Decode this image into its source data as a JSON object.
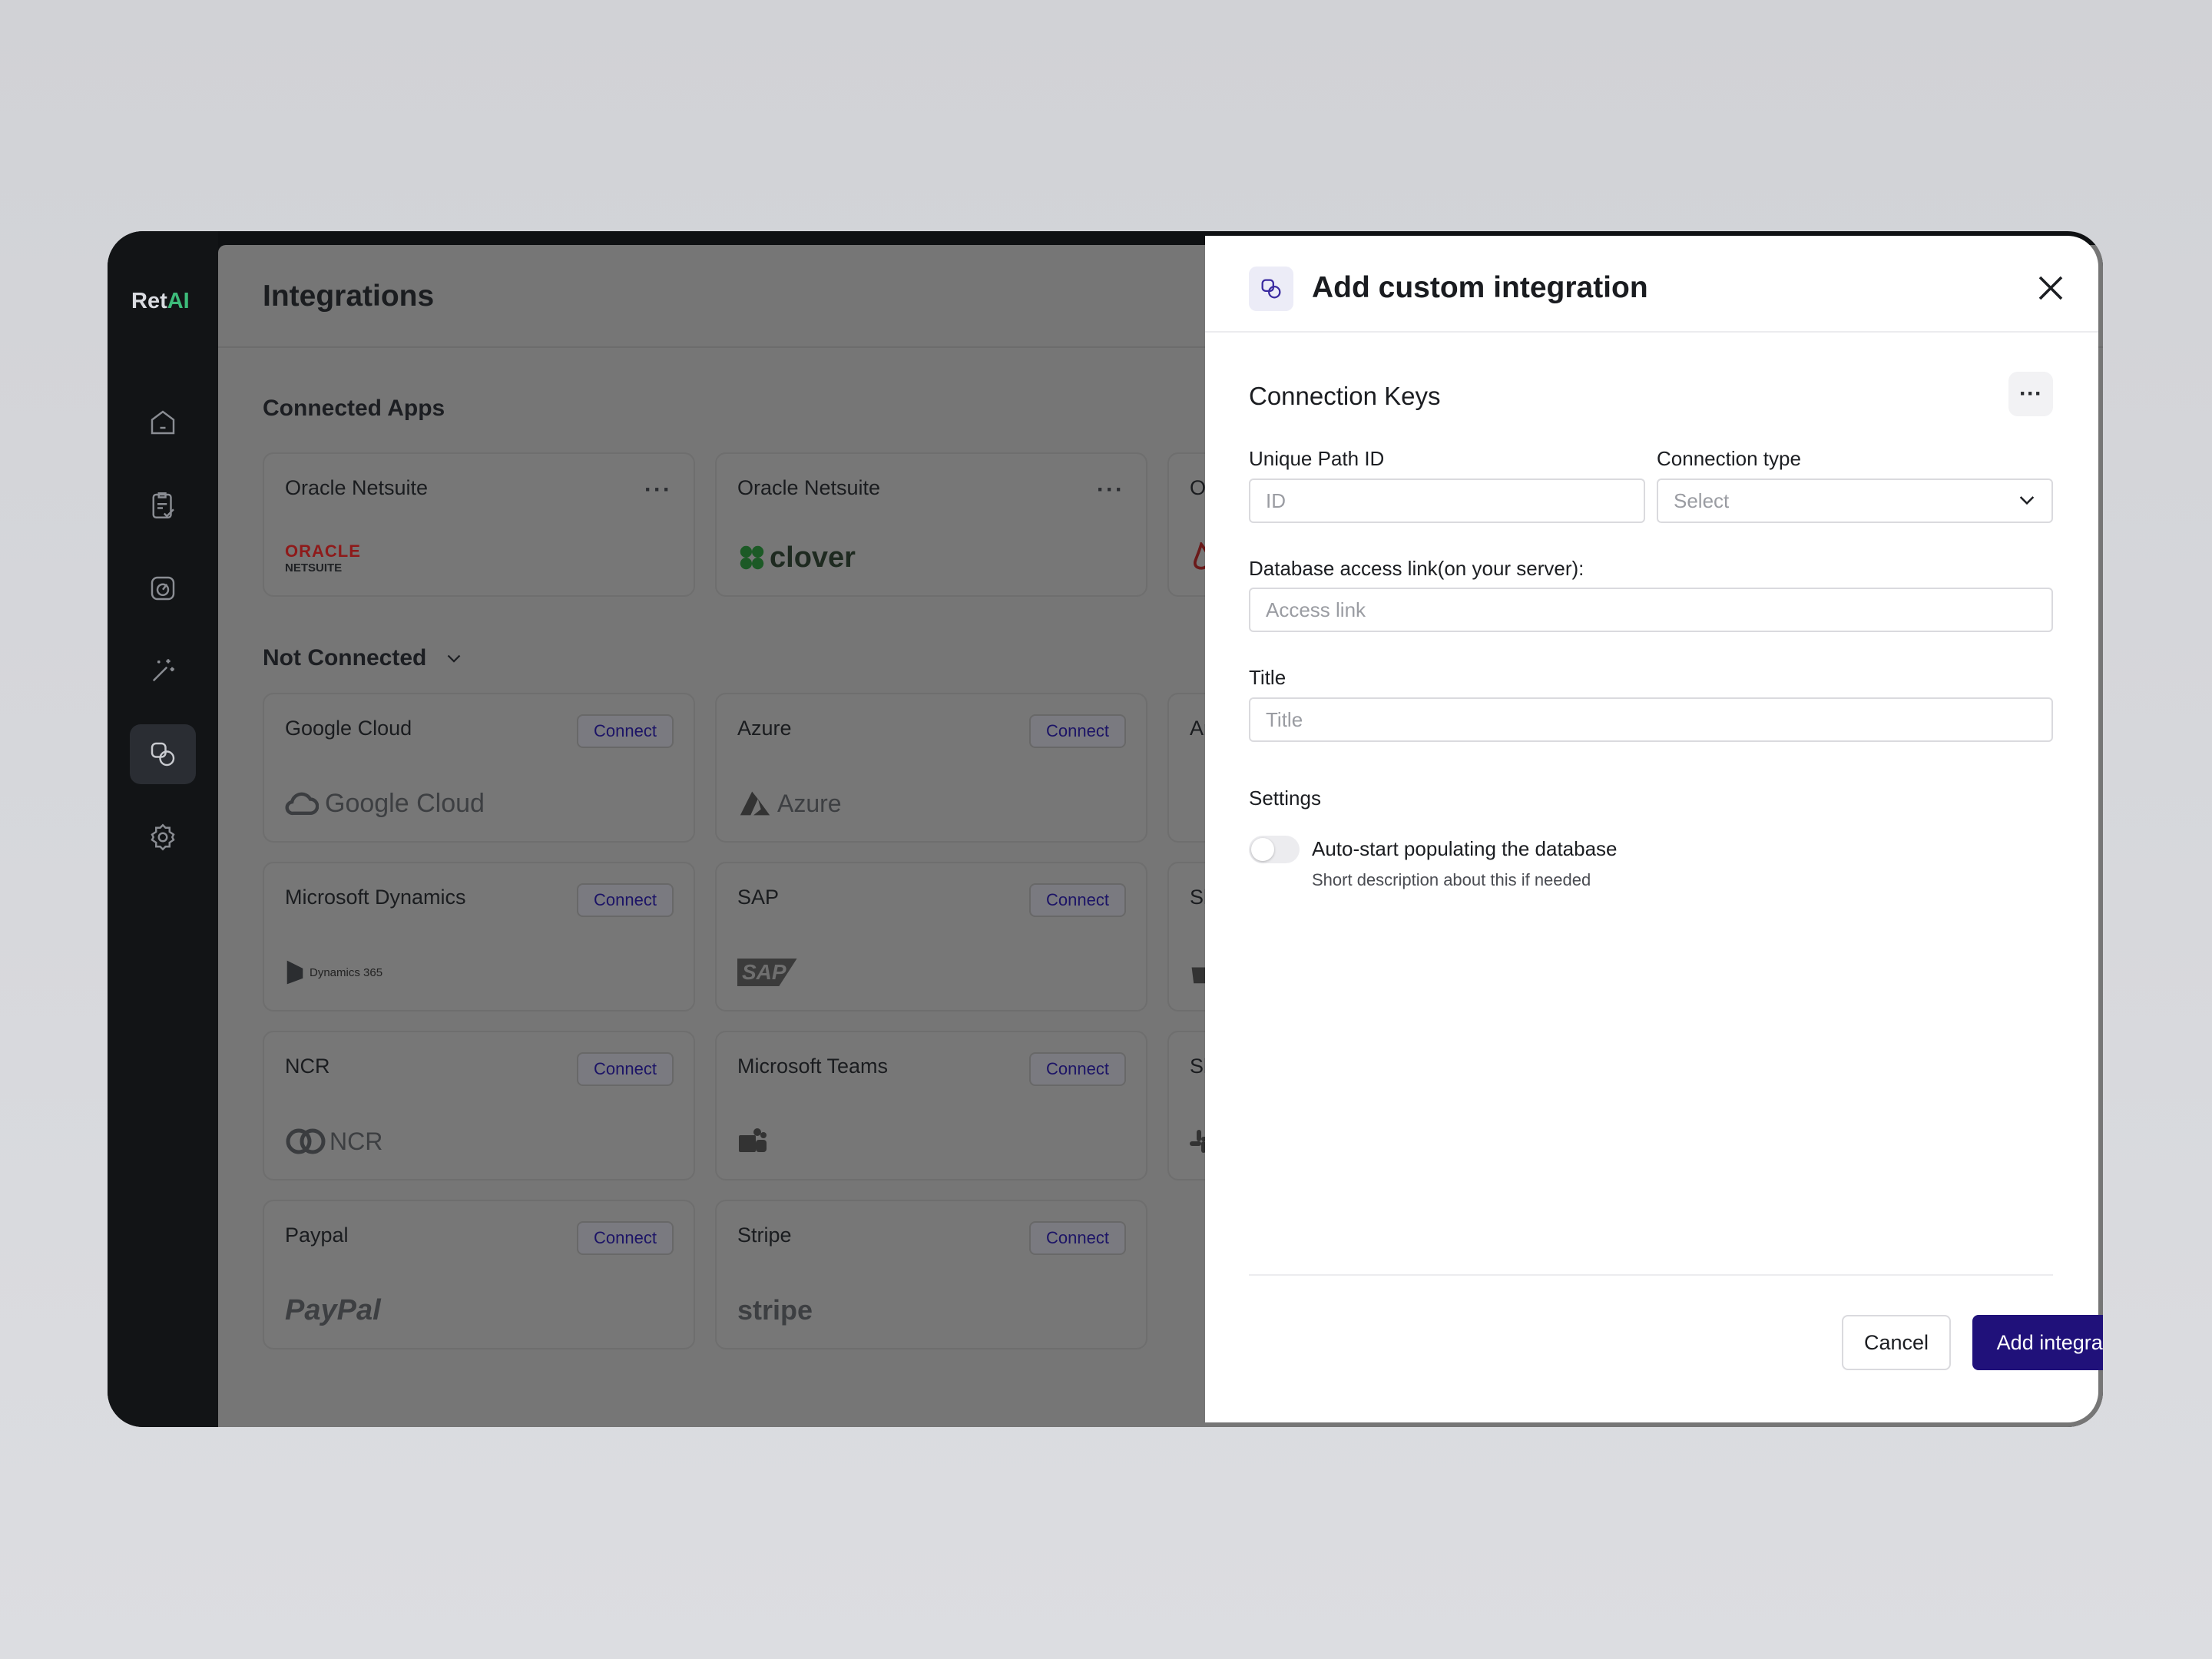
{
  "app": {
    "brand_prefix": "Ret",
    "brand_suffix": "AI",
    "nav_icons": [
      "home-icon",
      "clipboard-check-icon",
      "gauge-icon",
      "magic-wand-icon",
      "integrations-icon",
      "settings-gear-icon"
    ],
    "active_nav": "integrations-icon"
  },
  "page": {
    "title": "Integrations",
    "connected_title": "Connected Apps",
    "not_connected_title": "Not Connected"
  },
  "connected_apps": [
    {
      "name": "Oracle Netsuite",
      "logo_main": "ORACLE",
      "logo_sub": "NETSUITE"
    },
    {
      "name": "Oracle Netsuite",
      "logo_main": "clover"
    },
    {
      "name": "O"
    }
  ],
  "not_connected": [
    {
      "name": "Google Cloud",
      "button": "Connect",
      "logo": "Google Cloud"
    },
    {
      "name": "Azure",
      "button": "Connect",
      "logo": "Azure"
    },
    {
      "name": "Ar"
    },
    {
      "name": "Microsoft Dynamics",
      "button": "Connect",
      "logo": "Dynamics 365"
    },
    {
      "name": "SAP",
      "button": "Connect",
      "logo": "SAP"
    },
    {
      "name": "Sl"
    },
    {
      "name": "NCR",
      "button": "Connect",
      "logo": "NCR"
    },
    {
      "name": "Microsoft Teams",
      "button": "Connect"
    },
    {
      "name": "Sl"
    },
    {
      "name": "Paypal",
      "button": "Connect",
      "logo": "PayPal"
    },
    {
      "name": "Stripe",
      "button": "Connect",
      "logo": "stripe"
    }
  ],
  "drawer": {
    "title": "Add custom integration",
    "section": "Connection Keys",
    "fields": {
      "path_id_label": "Unique Path ID",
      "path_id_placeholder": "ID",
      "conn_type_label": "Connection type",
      "conn_type_value": "Select",
      "db_link_label": "Database access link(on your server):",
      "db_link_placeholder": "Access link",
      "title_label": "Title",
      "title_placeholder": "Title"
    },
    "settings": {
      "label": "Settings",
      "toggle_label": "Auto-start populating the database",
      "toggle_desc": "Short description about this if needed",
      "toggle_on": false
    },
    "buttons": {
      "cancel": "Cancel",
      "submit": "Add integration"
    }
  },
  "colors": {
    "primary": "#20117a",
    "brand_accent": "#3dbb7a",
    "sidebar_bg": "#121416"
  }
}
